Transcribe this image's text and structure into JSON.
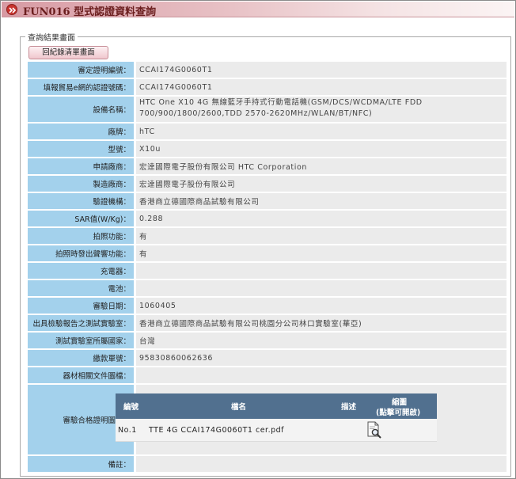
{
  "header": {
    "title": "FUN016 型式認證資料查詢",
    "icon": "double-chevron-right-icon"
  },
  "section": {
    "legend": "查詢結果畫面",
    "back_button": "回紀錄清單畫面"
  },
  "fields": [
    {
      "label": "審定證明編號：",
      "value": "CCAI174G0060T1"
    },
    {
      "label": "填報貿易e網的認證號碼：",
      "value": "CCAI174G0060T1"
    },
    {
      "label": "設備名稱：",
      "value": "HTC One X10 4G 無線藍牙手持式行動電話機(GSM/DCS/WCDMA/LTE FDD 700/900/1800/2600,TDD 2570-2620MHz/WLAN/BT/NFC)"
    },
    {
      "label": "廠牌：",
      "value": "hTC"
    },
    {
      "label": "型號：",
      "value": "X10u"
    },
    {
      "label": "申請廠商：",
      "value": "宏達國際電子股份有限公司 HTC Corporation"
    },
    {
      "label": "製造廠商：",
      "value": "宏達國際電子股份有限公司"
    },
    {
      "label": "驗證機構：",
      "value": "香港商立德國際商品試驗有限公司"
    },
    {
      "label": "SAR值(W/Kg)：",
      "value": "0.288"
    },
    {
      "label": "拍照功能：",
      "value": "有"
    },
    {
      "label": "拍照時發出聲響功能：",
      "value": "有"
    },
    {
      "label": "充電器：",
      "value": ""
    },
    {
      "label": "電池：",
      "value": ""
    },
    {
      "label": "審驗日期：",
      "value": "1060405"
    },
    {
      "label": "出具檢驗報告之測試實驗室：",
      "value": "香港商立德國際商品試驗有限公司桃園分公司林口實驗室(華亞)"
    },
    {
      "label": "測試實驗室所屬國家：",
      "value": "台灣"
    },
    {
      "label": "繳款單號：",
      "value": "95830860062636"
    },
    {
      "label": "器材相關文件圖檔：",
      "value": ""
    },
    {
      "label": "審驗合格證明圖檔：",
      "value": ""
    },
    {
      "label": "備註：",
      "value": ""
    }
  ],
  "cert_table": {
    "headers": {
      "number": "編號",
      "filename": "檔名",
      "description": "描述",
      "thumbnail_line1": "縮圖",
      "thumbnail_line2": "(點擊可開啟)"
    },
    "rows": [
      {
        "number": "No.1",
        "filename": "TTE 4G CCAI174G0060T1 cer.pdf",
        "description": "",
        "thumbnail_icon": "document-magnifier-icon"
      }
    ]
  },
  "colors": {
    "label_bg": "#a3d1ec",
    "value_bg": "#ebebeb",
    "table_header_bg": "#51708f",
    "title_color": "#6b1e1e"
  }
}
